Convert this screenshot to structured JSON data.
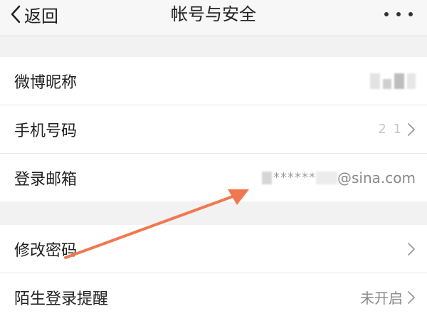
{
  "navbar": {
    "back_label": "返回",
    "title": "帐号与安全"
  },
  "groups": [
    {
      "rows": [
        {
          "label": "微博昵称"
        },
        {
          "label": "手机号码",
          "value_partial": "2 1"
        },
        {
          "label": "登录邮箱",
          "value_masked": "******",
          "value_domain": "@sina.com"
        }
      ]
    },
    {
      "rows": [
        {
          "label": "修改密码"
        },
        {
          "label": "陌生登录提醒",
          "value": "未开启"
        }
      ]
    }
  ],
  "colors": {
    "annotation_arrow": "#f07850",
    "background": "#f2f2f2",
    "secondary_text": "#8a8a8a"
  },
  "icons": [
    "chevron-left-icon",
    "more-dots-icon",
    "chevron-right-icon",
    "annotation-arrow"
  ]
}
